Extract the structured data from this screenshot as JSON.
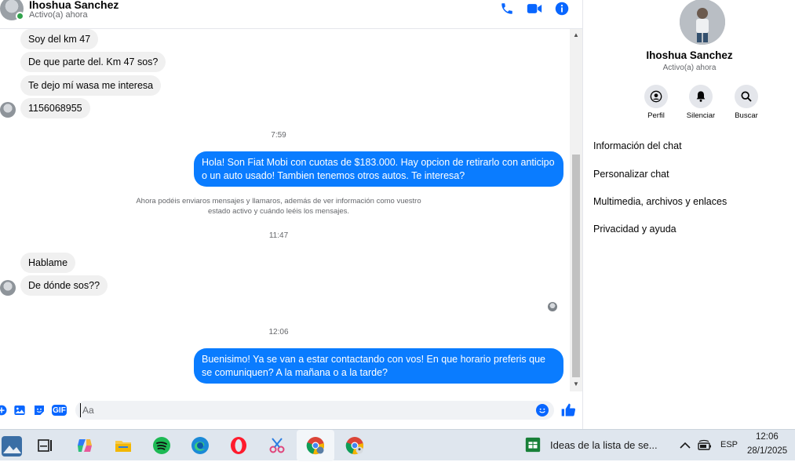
{
  "header": {
    "name": "Ihoshua Sanchez",
    "status": "Activo(a) ahora"
  },
  "messages": {
    "in1": "Soy del km 47",
    "in2": "De que parte del. Km 47 sos?",
    "in3": "Te dejo mí wasa me interesa",
    "in4": "1156068955",
    "time1": "7:59",
    "out1": "Hola! Son Fiat Mobi con cuotas de $183.000. Hay opcion de retirarlo con anticipo o un auto usado! Tambien tenemos otros autos. Te interesa?",
    "system_note": "Ahora podéis enviaros mensajes y llamaros, además de ver información como vuestro estado activo y cuándo leéis los mensajes.",
    "time2": "11:47",
    "in5": "Hablame",
    "in6": "De dónde sos??",
    "time3": "12:06",
    "out2": "Buenisimo! Ya se van a estar contactando con vos! En que horario preferis que se comuniquen? A la mañana o a la tarde?"
  },
  "composer": {
    "placeholder": "Aa",
    "gif_label": "GIF"
  },
  "side": {
    "name": "Ihoshua Sanchez",
    "status": "Activo(a) ahora",
    "actions": [
      "Perfil",
      "Silenciar",
      "Buscar"
    ],
    "menu": [
      "Información del chat",
      "Personalizar chat",
      "Multimedia, archivos y enlaces",
      "Privacidad y ayuda"
    ]
  },
  "taskbar": {
    "active_window": "Ideas de la lista de se...",
    "language": "ESP",
    "time": "12:06",
    "date": "28/1/2025"
  },
  "colors": {
    "accent": "#0866ff",
    "outgoing_bubble": "#0a7cff",
    "incoming_bubble": "#f0f0f0",
    "online": "#31a24c"
  }
}
